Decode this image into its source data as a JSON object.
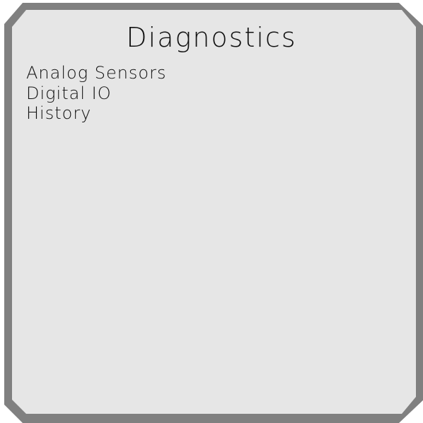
{
  "screen": {
    "title": "Diagnostics"
  },
  "menu": {
    "items": [
      {
        "label": "Analog Sensors"
      },
      {
        "label": "Digital IO"
      },
      {
        "label": "History"
      }
    ]
  }
}
